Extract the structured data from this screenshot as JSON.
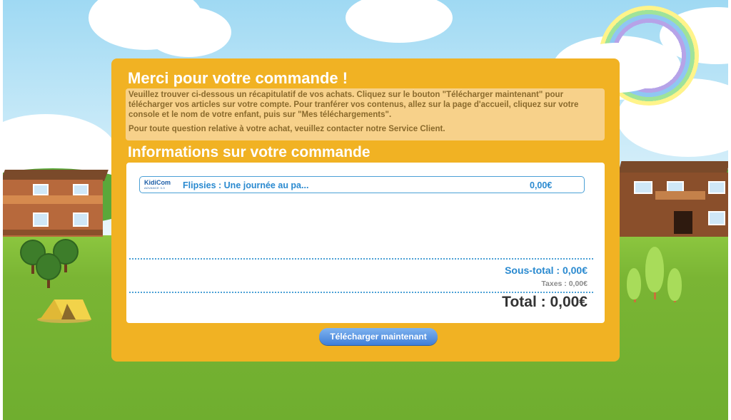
{
  "panel": {
    "title": "Merci pour votre commande !",
    "intro_paragraph": "Veuillez trouver ci-dessous un récapitulatif de vos achats. Cliquez sur le bouton \"Télécharger maintenant\" pour télécharger vos articles sur votre compte. Pour tranférer vos contenus, allez sur la page d'accueil, cliquez sur votre console et le nom de votre enfant, puis sur \"Mes téléchargements\".",
    "contact_paragraph": "Pour toute question relative à votre achat, veuillez contacter notre Service Client.",
    "order_title": "Informations sur votre commande"
  },
  "order": {
    "items": [
      {
        "brand_logo": "KidiCom",
        "brand_sub": "ADVANCE 3.0",
        "brand_icon": "kidicom-logo-icon",
        "name": "Flipsies : Une journée au pa...",
        "price": "0,00€"
      }
    ],
    "subtotal": "Sous-total : 0,00€",
    "taxes": "Taxes : 0,00€",
    "total": "Total : 0,00€"
  },
  "actions": {
    "download_label": "Télécharger maintenant"
  },
  "colors": {
    "panel": "#f1b223",
    "info_box": "#f7d18a",
    "accent_blue": "#2a8ad0",
    "button": "#4f8fe0"
  }
}
